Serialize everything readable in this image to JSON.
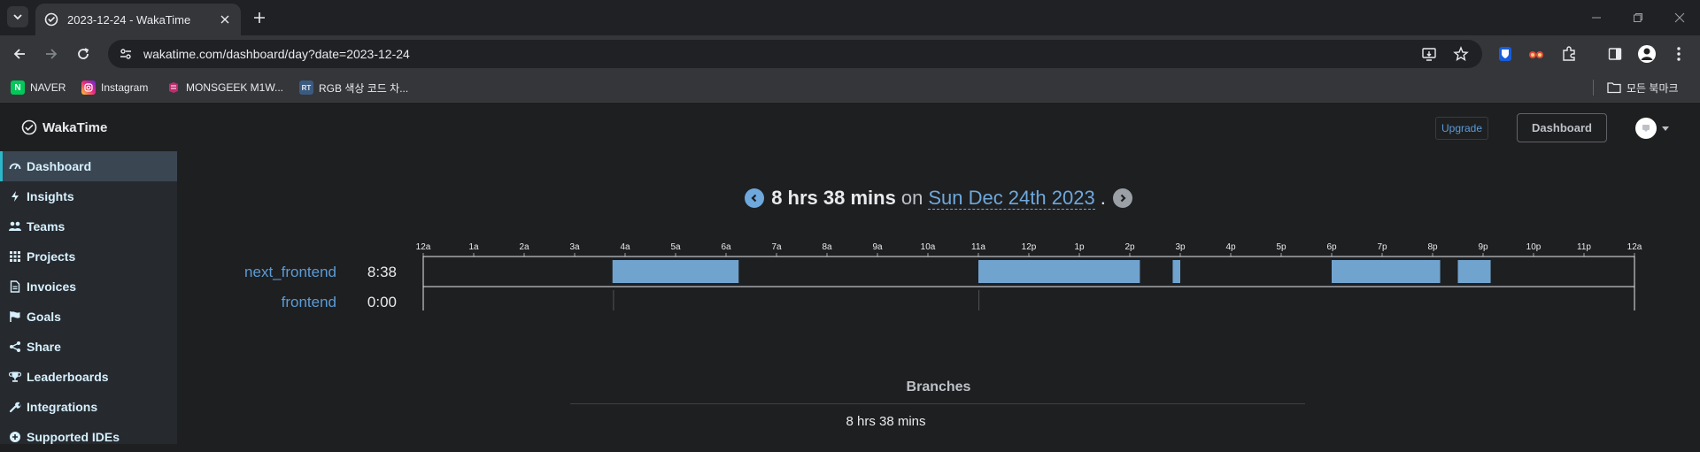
{
  "browser": {
    "tab_title": "2023-12-24 - WakaTime",
    "url": "wakatime.com/dashboard/day?date=2023-12-24",
    "bookmarks": [
      {
        "label": "NAVER",
        "icon": "naver-icon",
        "color": "#03c75a",
        "glyph": "N"
      },
      {
        "label": "Instagram",
        "icon": "instagram-icon",
        "color": "#d6249f",
        "glyph": ""
      },
      {
        "label": "MONSGEEK M1W...",
        "icon": "monsgeek-icon",
        "color": "#c02a6e",
        "glyph": ""
      },
      {
        "label": "RGB 색상 코드 차...",
        "icon": "rt-icon",
        "color": "#3b5a80",
        "glyph": "RT"
      }
    ],
    "all_bookmarks_label": "모든 북마크"
  },
  "header": {
    "brand": "WakaTime",
    "upgrade_label": "Upgrade",
    "dashboard_label": "Dashboard"
  },
  "sidebar": {
    "items": [
      {
        "label": "Dashboard",
        "icon": "dashboard-icon",
        "active": true
      },
      {
        "label": "Insights",
        "icon": "bolt-icon"
      },
      {
        "label": "Teams",
        "icon": "users-icon"
      },
      {
        "label": "Projects",
        "icon": "grid-icon"
      },
      {
        "label": "Invoices",
        "icon": "file-icon"
      },
      {
        "label": "Goals",
        "icon": "flag-icon"
      },
      {
        "label": "Share",
        "icon": "share-icon"
      },
      {
        "label": "Leaderboards",
        "icon": "trophy-icon"
      },
      {
        "label": "Integrations",
        "icon": "wrench-icon"
      },
      {
        "label": "Supported IDEs",
        "icon": "plus-circle-icon"
      }
    ]
  },
  "summary": {
    "total": "8 hrs 38 mins",
    "on_word": "on",
    "date": "Sun Dec 24th 2023",
    "period": "."
  },
  "colors": {
    "accent": "#6ea8dc",
    "bar": "#71a3cf",
    "active_border": "#2bb8ca"
  },
  "timeline": {
    "hour_labels": [
      "12a",
      "1a",
      "2a",
      "3a",
      "4a",
      "5a",
      "6a",
      "7a",
      "8a",
      "9a",
      "10a",
      "11a",
      "12p",
      "1p",
      "2p",
      "3p",
      "4p",
      "5p",
      "6p",
      "7p",
      "8p",
      "9p",
      "10p",
      "11p",
      "12a"
    ],
    "projects": [
      {
        "name": "next_frontend",
        "time": "8:38",
        "segments": [
          [
            3.75,
            6.25
          ],
          [
            11.0,
            14.2
          ],
          [
            14.85,
            15.0
          ],
          [
            18.0,
            20.15
          ],
          [
            20.5,
            21.15
          ]
        ]
      },
      {
        "name": "frontend",
        "time": "0:00",
        "segments": [
          [
            3.76,
            3.78
          ],
          [
            11.0,
            11.02
          ]
        ]
      }
    ]
  },
  "branches": {
    "title": "Branches",
    "value": "8 hrs 38 mins"
  }
}
